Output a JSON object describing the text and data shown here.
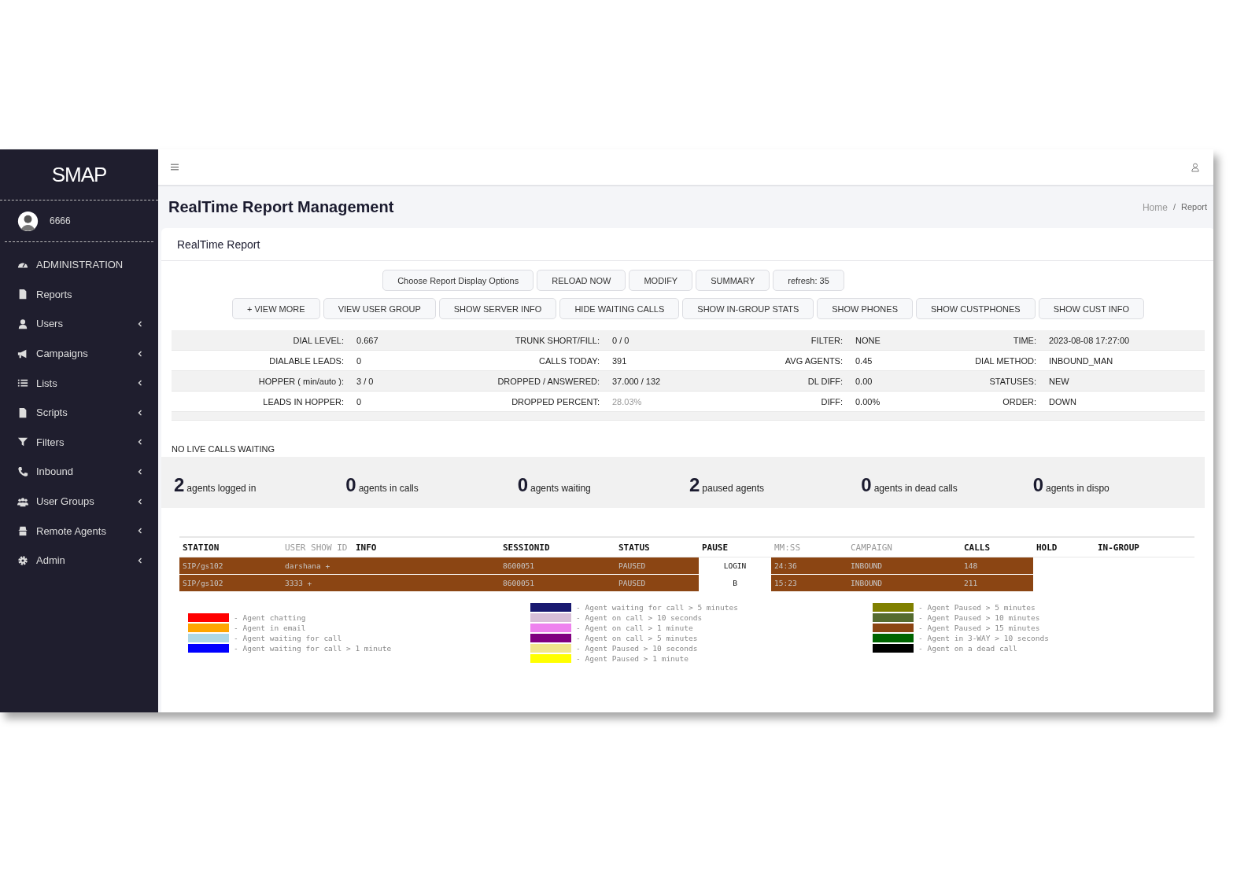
{
  "sidebar": {
    "logo": "SMAP",
    "user": {
      "name": "6666"
    },
    "items": [
      {
        "label": "ADMINISTRATION",
        "has_submenu": false
      },
      {
        "label": "Reports",
        "has_submenu": false
      },
      {
        "label": "Users",
        "has_submenu": true
      },
      {
        "label": "Campaigns",
        "has_submenu": true
      },
      {
        "label": "Lists",
        "has_submenu": true
      },
      {
        "label": "Scripts",
        "has_submenu": true
      },
      {
        "label": "Filters",
        "has_submenu": true
      },
      {
        "label": "Inbound",
        "has_submenu": true
      },
      {
        "label": "User Groups",
        "has_submenu": true
      },
      {
        "label": "Remote Agents",
        "has_submenu": true
      },
      {
        "label": "Admin",
        "has_submenu": true
      }
    ]
  },
  "page": {
    "title": "RealTime Report Management",
    "breadcrumb": {
      "items": [
        "Home",
        "Report"
      ],
      "separator": "/"
    }
  },
  "card": {
    "title": "RealTime Report",
    "buttons_row_1": [
      "Choose Report Display Options",
      "RELOAD NOW",
      "MODIFY",
      "SUMMARY",
      "refresh: 35"
    ],
    "buttons_row_2": [
      "+ VIEW MORE",
      "VIEW USER GROUP",
      "SHOW SERVER INFO",
      "HIDE WAITING CALLS",
      "SHOW IN-GROUP STATS",
      "SHOW PHONES",
      "SHOW CUSTPHONES",
      "SHOW CUST INFO"
    ],
    "stats": [
      [
        {
          "label": "DIAL LEVEL:",
          "value": "0.667",
          "muted": false
        },
        {
          "label": "TRUNK SHORT/FILL:",
          "value": "0 / 0",
          "muted": false
        },
        {
          "label": "FILTER:",
          "value": "NONE",
          "muted": false
        },
        {
          "label": "TIME:",
          "value": "2023-08-08 17:27:00",
          "muted": false
        }
      ],
      [
        {
          "label": "DIALABLE LEADS:",
          "value": "0",
          "muted": false
        },
        {
          "label": "CALLS TODAY:",
          "value": "391",
          "muted": false
        },
        {
          "label": "AVG AGENTS:",
          "value": "0.45",
          "muted": false
        },
        {
          "label": "DIAL METHOD:",
          "value": "INBOUND_MAN",
          "muted": false
        }
      ],
      [
        {
          "label": "HOPPER ( min/auto ):",
          "value": "3 / 0",
          "muted": false
        },
        {
          "label": "DROPPED / ANSWERED:",
          "value": "37.000 / 132",
          "muted": false
        },
        {
          "label": "DL DIFF:",
          "value": "0.00",
          "muted": false
        },
        {
          "label": "STATUSES:",
          "value": "NEW",
          "muted": false
        }
      ],
      [
        {
          "label": "LEADS IN HOPPER:",
          "value": "0",
          "muted": false
        },
        {
          "label": "DROPPED PERCENT:",
          "value": "28.03%",
          "muted": true
        },
        {
          "label": "DIFF:",
          "value": "0.00%",
          "muted": false
        },
        {
          "label": "ORDER:",
          "value": "DOWN",
          "muted": false
        }
      ]
    ],
    "waiting_notice": "NO LIVE CALLS WAITING",
    "agent_counts": [
      {
        "count": "2",
        "label": "agents logged in"
      },
      {
        "count": "0",
        "label": "agents in calls"
      },
      {
        "count": "0",
        "label": "agents waiting"
      },
      {
        "count": "2",
        "label": "paused agents"
      },
      {
        "count": "0",
        "label": "agents in dead calls"
      },
      {
        "count": "0",
        "label": "agents in dispo"
      }
    ],
    "agents_table": {
      "columns": [
        {
          "label": "STATION",
          "muted": false
        },
        {
          "label": "USER SHOW ID",
          "muted": true
        },
        {
          "label": "INFO",
          "muted": false
        },
        {
          "label": "SESSIONID",
          "muted": false
        },
        {
          "label": "STATUS",
          "muted": false
        },
        {
          "label": "PAUSE",
          "muted": false
        },
        {
          "label": "MM:SS",
          "muted": true
        },
        {
          "label": "CAMPAIGN",
          "muted": true
        },
        {
          "label": "CALLS",
          "muted": false
        },
        {
          "label": "HOLD",
          "muted": false
        },
        {
          "label": "IN-GROUP",
          "muted": false
        }
      ],
      "rows": [
        {
          "color": "#8b4513",
          "station": "SIP/gs102",
          "user": "darshana +",
          "session_id": "8600051",
          "status": "PAUSED",
          "pause": "LOGIN",
          "time": "24:36",
          "campaign": "INBOUND",
          "calls": "148"
        },
        {
          "color": "#8b4513",
          "station": "SIP/gs102",
          "user": "3333 +",
          "session_id": "8600051",
          "status": "PAUSED",
          "pause": "B",
          "time": "15:23",
          "campaign": "INBOUND",
          "calls": "211"
        }
      ]
    },
    "legend": [
      [
        {
          "color": "#ff0000",
          "label": "- Agent chatting"
        },
        {
          "color": "#ffa500",
          "label": "- Agent in email"
        },
        {
          "color": "#add8e6",
          "label": "- Agent waiting for call"
        },
        {
          "color": "#0000ff",
          "label": "- Agent waiting for call > 1 minute"
        }
      ],
      [
        {
          "color": "#191970",
          "label": "- Agent waiting for call > 5 minutes"
        },
        {
          "color": "#d8bfd8",
          "label": "- Agent on call > 10 seconds"
        },
        {
          "color": "#ee82ee",
          "label": "- Agent on call > 1 minute"
        },
        {
          "color": "#800080",
          "label": "- Agent on call > 5 minutes"
        },
        {
          "color": "#f0e68c",
          "label": "- Agent Paused > 10 seconds"
        },
        {
          "color": "#ffff00",
          "label": "- Agent Paused > 1 minute"
        }
      ],
      [
        {
          "color": "#808000",
          "label": "- Agent Paused > 5 minutes"
        },
        {
          "color": "#556b2f",
          "label": "- Agent Paused > 10 minutes"
        },
        {
          "color": "#8b4513",
          "label": "- Agent Paused > 15 minutes"
        },
        {
          "color": "#006400",
          "label": "- Agent in 3-WAY > 10 seconds"
        },
        {
          "color": "#000000",
          "label": "- Agent on a dead call"
        }
      ]
    ]
  }
}
